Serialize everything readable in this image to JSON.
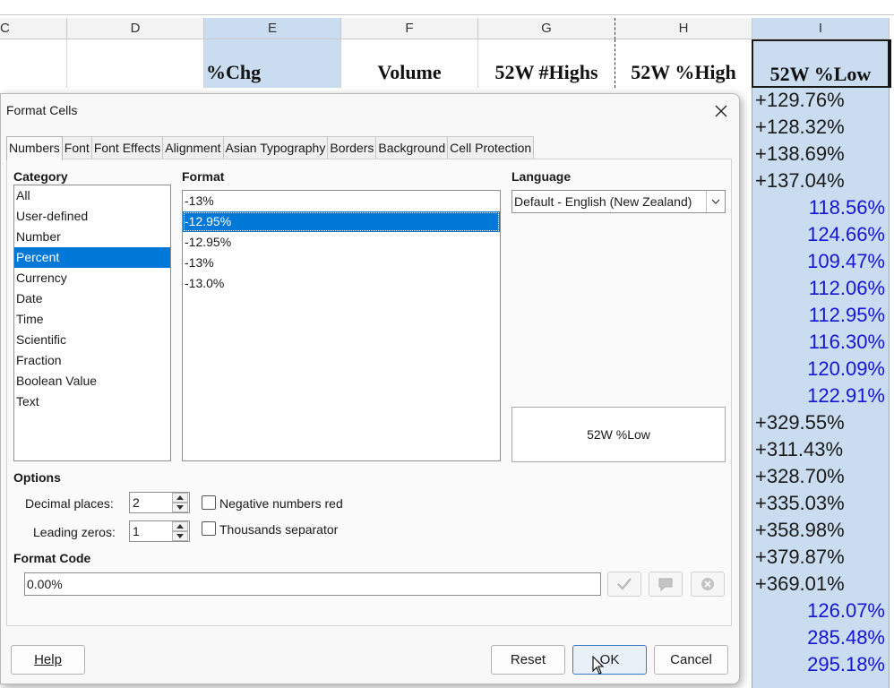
{
  "spreadsheet": {
    "columns": [
      {
        "letter": "C"
      },
      {
        "letter": "D"
      },
      {
        "letter": "E"
      },
      {
        "letter": "F"
      },
      {
        "letter": "G"
      },
      {
        "letter": "H"
      },
      {
        "letter": "I"
      }
    ],
    "header_row": {
      "E": "%Chg",
      "F": "Volume",
      "G": "52W #Highs",
      "H": "52W %High",
      "I": "52W %Low"
    },
    "column_I_values": [
      "+129.76%",
      "+128.32%",
      "+138.69%",
      "+137.04%",
      "118.56%",
      "124.66%",
      "109.47%",
      "112.06%",
      "112.95%",
      "116.30%",
      "120.09%",
      "122.91%",
      "+329.55%",
      "+311.43%",
      "+328.70%",
      "+335.03%",
      "+358.98%",
      "+379.87%",
      "+369.01%",
      "126.07%",
      "285.48%",
      "295.18%"
    ]
  },
  "dialog": {
    "title": "Format Cells",
    "tabs": [
      "Numbers",
      "Font",
      "Font Effects",
      "Alignment",
      "Asian Typography",
      "Borders",
      "Background",
      "Cell Protection"
    ],
    "category": {
      "label": "Category",
      "items": [
        "All",
        "User-defined",
        "Number",
        "Percent",
        "Currency",
        "Date",
        "Time",
        "Scientific",
        "Fraction",
        "Boolean Value",
        "Text"
      ],
      "selected": "Percent"
    },
    "format": {
      "label": "Format",
      "items": [
        "-13%",
        "-12.95%",
        "-12.95%",
        "-13%",
        "-13.0%"
      ],
      "selected_index": 1
    },
    "language": {
      "label": "Language",
      "value": "Default - English (New Zealand)"
    },
    "preview_text": "52W %Low",
    "options": {
      "label": "Options",
      "decimal_places_label": "Decimal places:",
      "decimal_places_value": "2",
      "leading_zeros_label": "Leading zeros:",
      "leading_zeros_value": "1",
      "negative_red_label": "Negative numbers red",
      "negative_red_checked": false,
      "thousands_label": "Thousands separator",
      "thousands_checked": false
    },
    "format_code": {
      "label": "Format Code",
      "value": "0.00%"
    },
    "buttons": {
      "help": "Help",
      "reset": "Reset",
      "ok": "OK",
      "cancel": "Cancel"
    }
  }
}
